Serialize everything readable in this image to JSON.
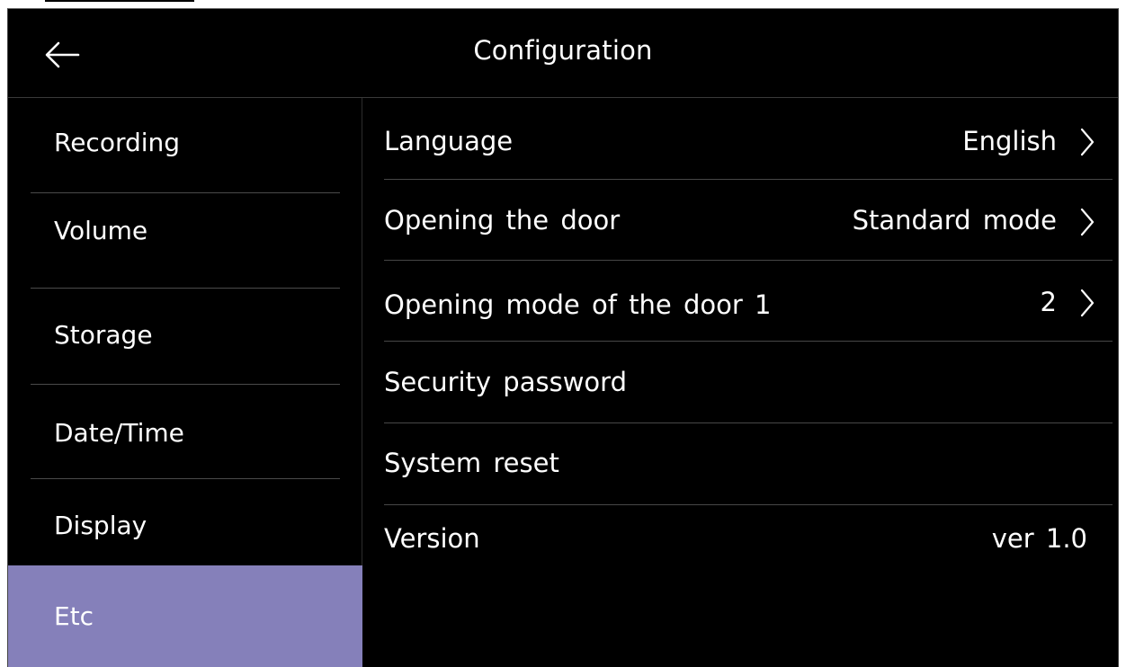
{
  "header": {
    "title": "Configuration",
    "back_icon": "arrow-left-icon"
  },
  "sidebar": {
    "items": [
      {
        "label": "Recording"
      },
      {
        "label": "Volume"
      },
      {
        "label": "Storage"
      },
      {
        "label": "Date/Time"
      },
      {
        "label": "Display"
      },
      {
        "label": "Etc",
        "active": true
      }
    ]
  },
  "settings": {
    "rows": [
      {
        "label": "Language",
        "value": "English",
        "icon": "chevron-right-icon"
      },
      {
        "label": "Opening the door",
        "value": "Standard mode",
        "icon": "chevron-right-icon"
      },
      {
        "label": "Opening mode of the door 1",
        "value": "2",
        "icon": "chevron-right-icon"
      },
      {
        "label": "Security password",
        "value": ""
      },
      {
        "label": "System reset",
        "value": ""
      },
      {
        "label": "Version",
        "value": "ver 1.0"
      }
    ]
  },
  "colors": {
    "background": "#000000",
    "text": "#ffffff",
    "active_tab": "#8580ba",
    "divider": "#474747"
  }
}
